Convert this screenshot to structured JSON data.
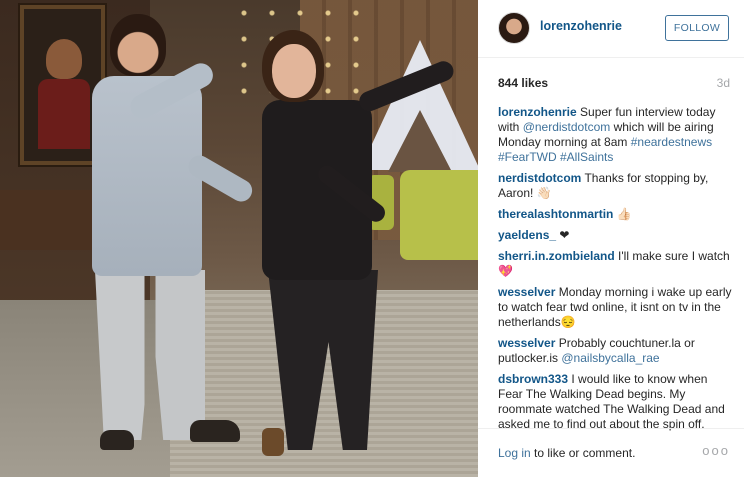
{
  "post": {
    "username": "lorenzohenrie",
    "follow_label": "FOLLOW",
    "likes": "844 likes",
    "age": "3d"
  },
  "comments": [
    {
      "user": "lorenzohenrie",
      "parts": [
        {
          "t": "Super fun interview today with "
        },
        {
          "t": "@nerdistdotcom",
          "mention": true
        },
        {
          "t": " which will be airing Monday morning at 8am "
        },
        {
          "t": "#neardestnews #FearTWD #AllSaints",
          "mention": true
        }
      ]
    },
    {
      "user": "nerdistdotcom",
      "parts": [
        {
          "t": "Thanks for stopping by, Aaron! 👋🏻"
        }
      ]
    },
    {
      "user": "therealashtonmartin",
      "parts": [
        {
          "t": "👍🏻"
        }
      ]
    },
    {
      "user": "yaeldens_",
      "parts": [
        {
          "t": "❤"
        }
      ]
    },
    {
      "user": "sherri.in.zombieland",
      "parts": [
        {
          "t": "I'll make sure I watch 💖"
        }
      ]
    },
    {
      "user": "wesselver",
      "parts": [
        {
          "t": "Monday morning i wake up early to watch fear twd online, it isnt on tv in the netherlands😔"
        }
      ]
    },
    {
      "user": "wesselver",
      "parts": [
        {
          "t": "Probably couchtuner.la or putlocker.is "
        },
        {
          "t": "@nailsbycalla_rae",
          "mention": true
        }
      ]
    },
    {
      "user": "dsbrown333",
      "parts": [
        {
          "t": "I would like to know when Fear The Walking Dead begins. My roommate watched The Walking Dead and asked me to find out about the spin off."
        }
      ]
    }
  ],
  "footer": {
    "login_link": "Log in",
    "login_text": " to like or comment.",
    "more_icon": "ellipsis-icon",
    "more_glyph": "ooo"
  }
}
